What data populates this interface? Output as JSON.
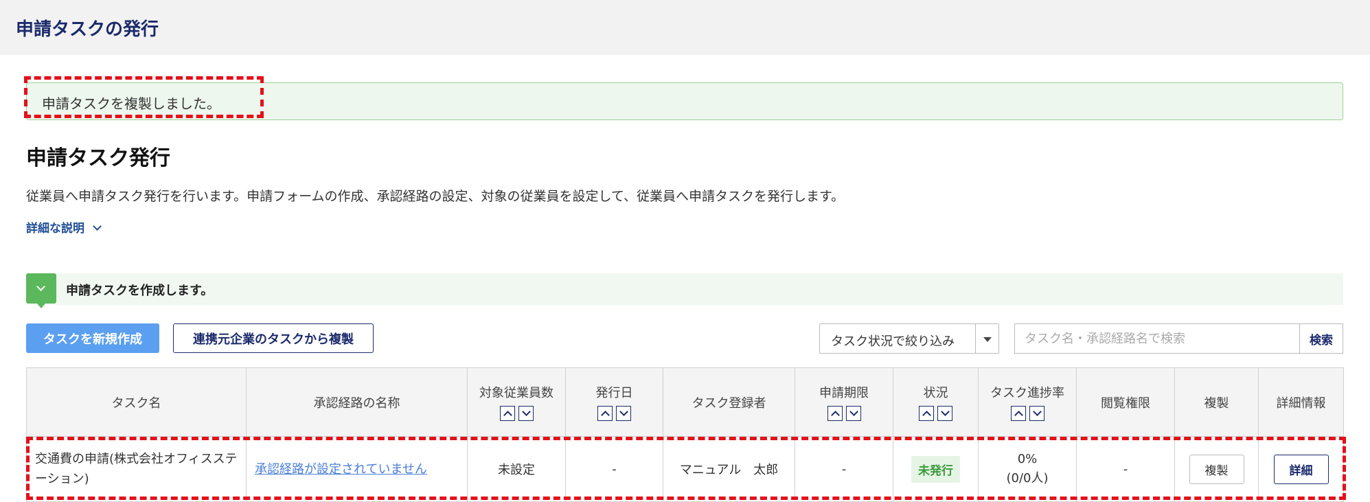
{
  "header": {
    "title": "申請タスクの発行"
  },
  "alert": {
    "message": "申請タスクを複製しました。"
  },
  "page": {
    "title": "申請タスク発行",
    "description": "従業員へ申請タスク発行を行います。申請フォームの作成、承認経路の設定、対象の従業員を設定して、従業員へ申請タスクを発行します。",
    "more_link": "詳細な説明"
  },
  "section": {
    "label": "申請タスクを作成します。"
  },
  "toolbar": {
    "new_task_label": "タスクを新規作成",
    "copy_from_partner_label": "連携元企業のタスクから複製",
    "filter_selected": "タスク状況で絞り込み",
    "search_placeholder": "タスク名・承認経路名で検索",
    "search_button": "検索"
  },
  "table": {
    "headers": [
      "タスク名",
      "承認経路の名称",
      "対象従業員数",
      "発行日",
      "タスク登録者",
      "申請期限",
      "状況",
      "タスク進捗率",
      "閲覧権限",
      "複製",
      "詳細情報"
    ],
    "rows": [
      {
        "task_name": "交通費の申請(株式会社オフィスステーション)",
        "route": "承認経路が設定されていません",
        "employees": "未設定",
        "issue_date": "-",
        "registrant": "マニュアル　太郎",
        "deadline": "-",
        "status": "未発行",
        "progress_pct": "0%",
        "progress_count": "(0/0人)",
        "permission": "-",
        "copy_label": "複製",
        "detail_label": "詳細"
      }
    ]
  },
  "colors": {
    "title_navy": "#1b2a6b",
    "primary_blue": "#5b9ff0",
    "success_green": "#5cb85c",
    "highlight_red": "#e4101a",
    "link_blue": "#4a7fd6"
  }
}
